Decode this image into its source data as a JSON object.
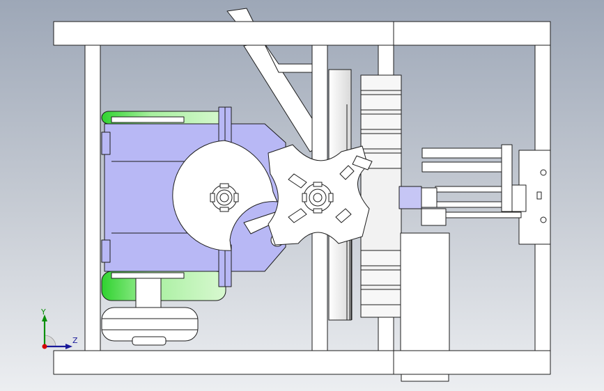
{
  "viewport": {
    "background_top": "#9da7b7",
    "background_bottom": "#eceef1"
  },
  "colors": {
    "frame": "#ffffff",
    "outline": "#1c1c1c",
    "motor_housing": "#b8b8f5",
    "motor_cap": "#bff0a8",
    "shaded_part": "#e4e4e4"
  },
  "triad": {
    "y_label": "Y",
    "z_label": "Z",
    "y_color": "#0a8f0a",
    "z_color": "#1a1a9a",
    "origin_color": "#d40000"
  }
}
